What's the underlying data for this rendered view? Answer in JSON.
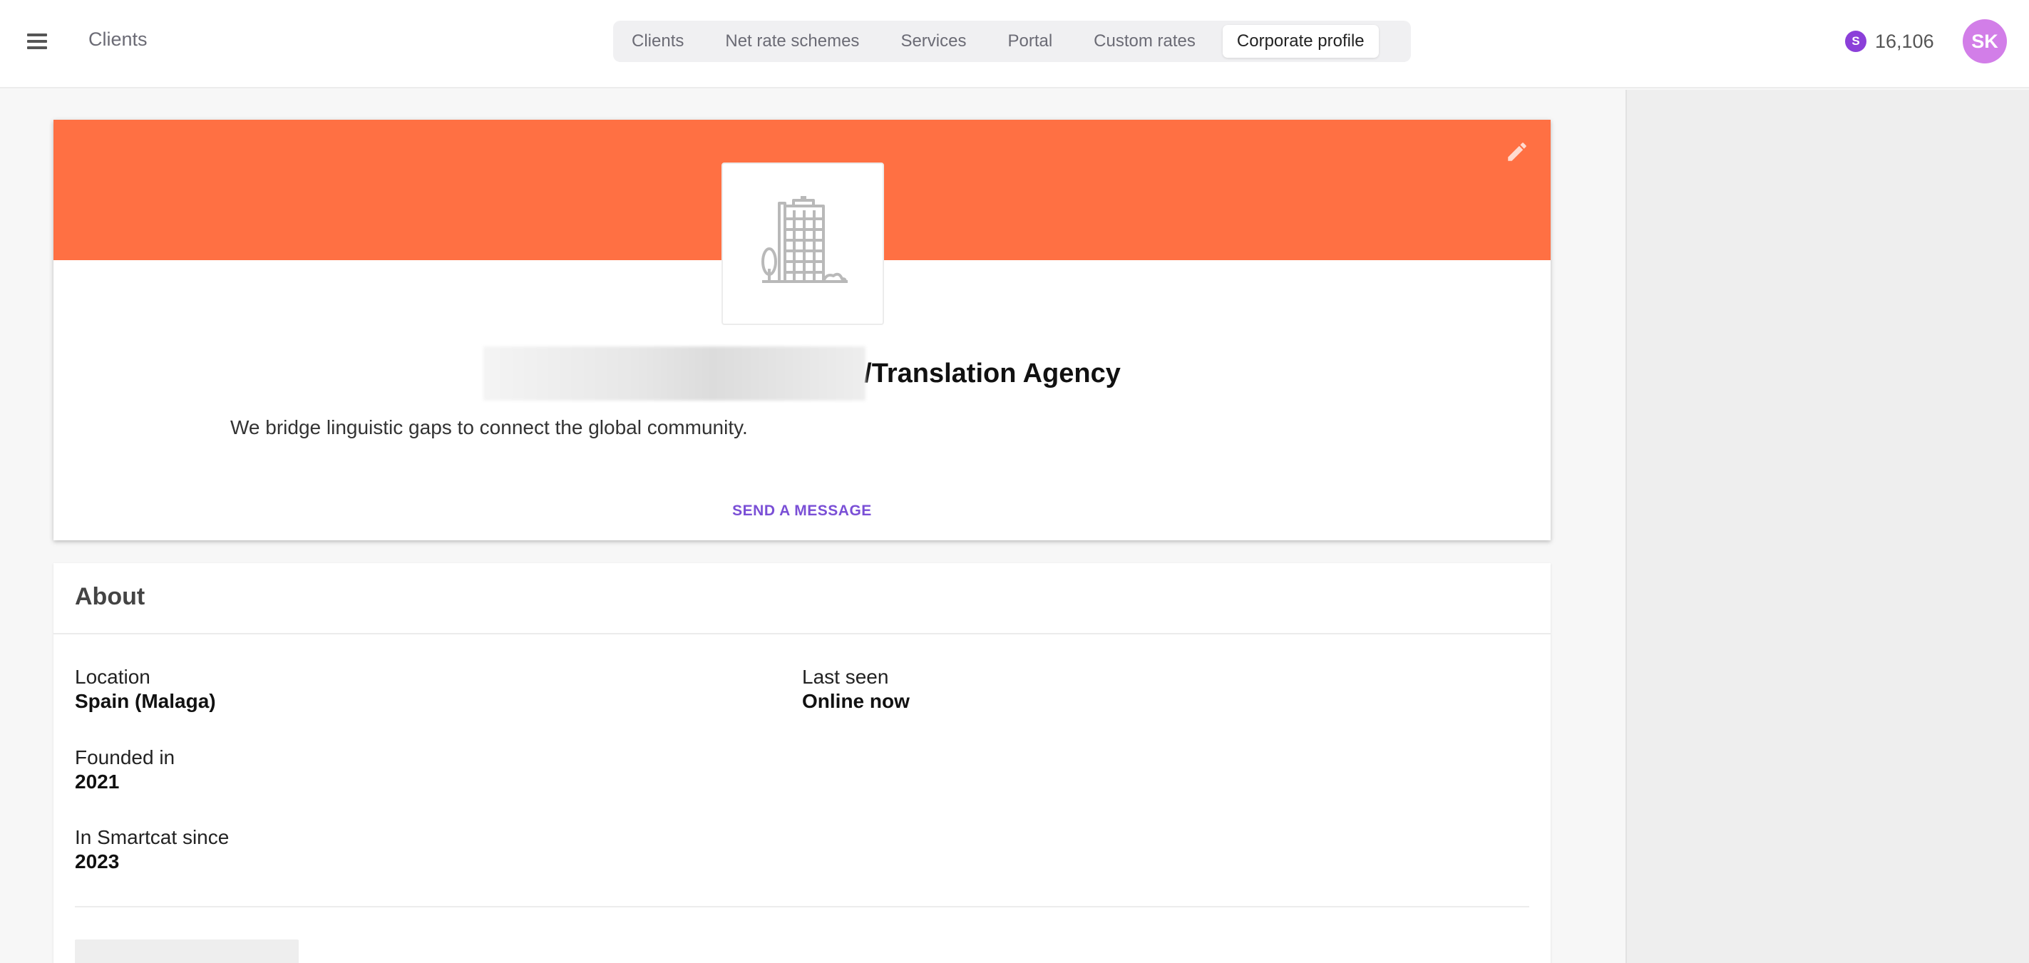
{
  "header": {
    "menu_icon": "hamburger-icon",
    "breadcrumb": "Clients",
    "tabs": [
      {
        "label": "Clients",
        "active": false
      },
      {
        "label": "Net rate schemes",
        "active": false
      },
      {
        "label": "Services",
        "active": false
      },
      {
        "label": "Portal",
        "active": false
      },
      {
        "label": "Custom rates",
        "active": false
      },
      {
        "label": "Corporate profile",
        "active": true
      }
    ],
    "balance": {
      "coin_symbol": "S",
      "value": "16,106",
      "coin_color": "#8b3fd9"
    },
    "avatar_initials": "SK",
    "avatar_color": "#d27ee8"
  },
  "profile": {
    "banner_color": "#ff7043",
    "edit_icon": "pencil-icon",
    "logo_icon": "building-icon",
    "name_suffix": "/Translation Agency",
    "tagline": "We bridge linguistic gaps to connect the global community.",
    "send_message_label": "SEND A MESSAGE",
    "accent_color": "#7a4fd6"
  },
  "about": {
    "title": "About",
    "location": {
      "label": "Location",
      "value": "Spain (Malaga)"
    },
    "last_seen": {
      "label": "Last seen",
      "value": "Online now"
    },
    "founded": {
      "label": "Founded in",
      "value": "2021"
    },
    "smartcat_since": {
      "label": "In Smartcat since",
      "value": "2023"
    }
  }
}
